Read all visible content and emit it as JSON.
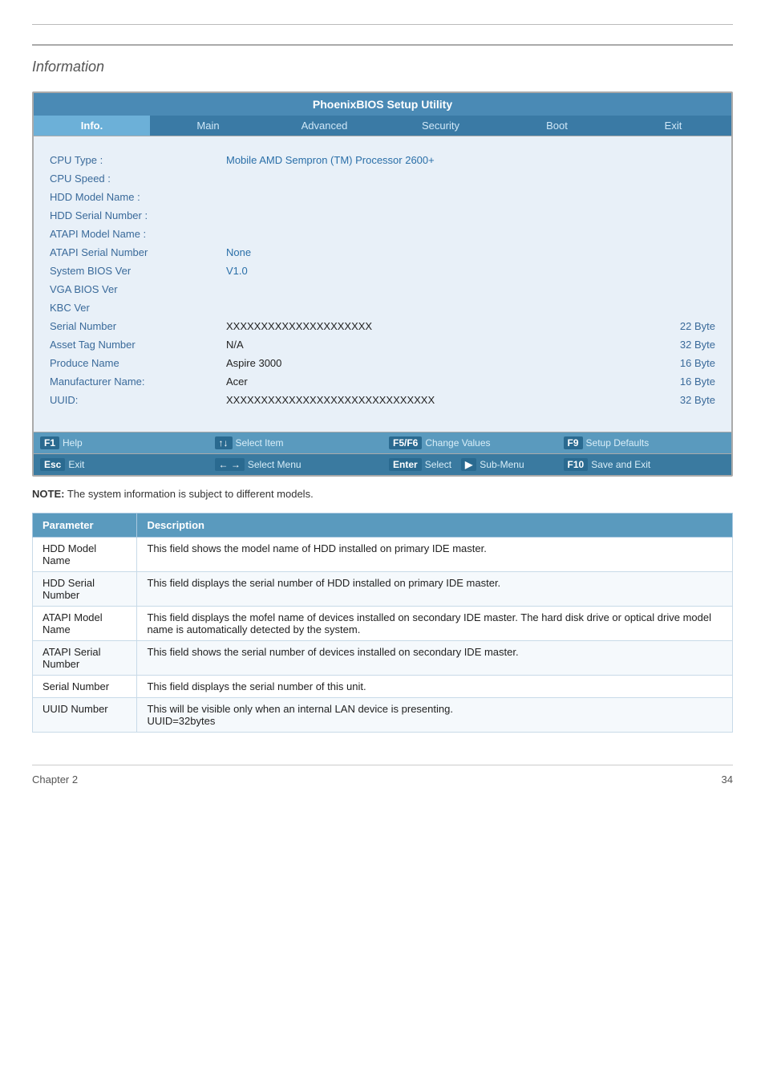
{
  "page": {
    "title": "Information"
  },
  "bios": {
    "title": "PhoenixBIOS Setup Utility",
    "nav": [
      {
        "label": "Info.",
        "active": true
      },
      {
        "label": "Main",
        "active": false
      },
      {
        "label": "Advanced",
        "active": false
      },
      {
        "label": "Security",
        "active": false
      },
      {
        "label": "Boot",
        "active": false
      },
      {
        "label": "Exit",
        "active": false
      }
    ],
    "fields": [
      {
        "label": "CPU Type :",
        "value": "Mobile AMD Sempron (TM) Processor 2600+",
        "byte": ""
      },
      {
        "label": "CPU Speed :",
        "value": "",
        "byte": ""
      },
      {
        "label": "HDD Model Name :",
        "value": "",
        "byte": ""
      },
      {
        "label": "HDD Serial Number :",
        "value": "",
        "byte": ""
      },
      {
        "label": "ATAPI Model Name :",
        "value": "",
        "byte": ""
      },
      {
        "label": "ATAPI Serial Number",
        "value": "None",
        "byte": ""
      },
      {
        "label": "System BIOS Ver",
        "value": "V1.0",
        "byte": ""
      },
      {
        "label": "VGA BIOS Ver",
        "value": "",
        "byte": ""
      },
      {
        "label": "KBC Ver",
        "value": "",
        "byte": ""
      },
      {
        "label": "Serial Number",
        "value": "XXXXXXXXXXXXXXXXXXXXX",
        "byte": "22 Byte"
      },
      {
        "label": "Asset Tag Number",
        "value": "N/A",
        "byte": "32 Byte"
      },
      {
        "label": "Produce Name",
        "value": "Aspire 3000",
        "byte": "16 Byte"
      },
      {
        "label": "Manufacturer Name:",
        "value": "Acer",
        "byte": "16 Byte"
      },
      {
        "label": "UUID:",
        "value": "XXXXXXXXXXXXXXXXXXXXXXXXXXXXXX",
        "byte": "32 Byte"
      }
    ],
    "statusbar": [
      {
        "key": "F1",
        "desc": "Help",
        "key2": "↑↓",
        "desc2": "Select Item",
        "key3": "F5/F6",
        "desc3": "Change Values",
        "key4": "F9",
        "desc4": "Setup Defaults"
      },
      {
        "key": "Esc",
        "desc": "Exit",
        "key2": "← →",
        "desc2": "Select Menu",
        "key3": "Enter",
        "desc3": "Select",
        "key4": "▶ Sub-Menu",
        "desc4": "F10 Save and Exit"
      }
    ]
  },
  "note": {
    "label": "NOTE:",
    "text": "The system information is subject to different models."
  },
  "table": {
    "headers": [
      "Parameter",
      "Description"
    ],
    "rows": [
      {
        "param": "HDD Model Name",
        "desc": "This field shows the model name of HDD installed on primary IDE master."
      },
      {
        "param": "HDD Serial Number",
        "desc": "This field displays the serial number of HDD installed on primary IDE master."
      },
      {
        "param": "ATAPI Model Name",
        "desc": "This field displays the mofel name of devices installed on secondary IDE master. The hard disk drive or optical drive model name is automatically detected by the system."
      },
      {
        "param": "ATAPI Serial Number",
        "desc": "This field shows the serial number of devices installed on secondary IDE master."
      },
      {
        "param": "Serial Number",
        "desc": "This field displays the serial number of this unit."
      },
      {
        "param": "UUID Number",
        "desc": "This will be visible only when an internal LAN device is presenting.\nUUID=32bytes"
      }
    ]
  },
  "footer": {
    "chapter": "Chapter 2",
    "page": "34"
  }
}
